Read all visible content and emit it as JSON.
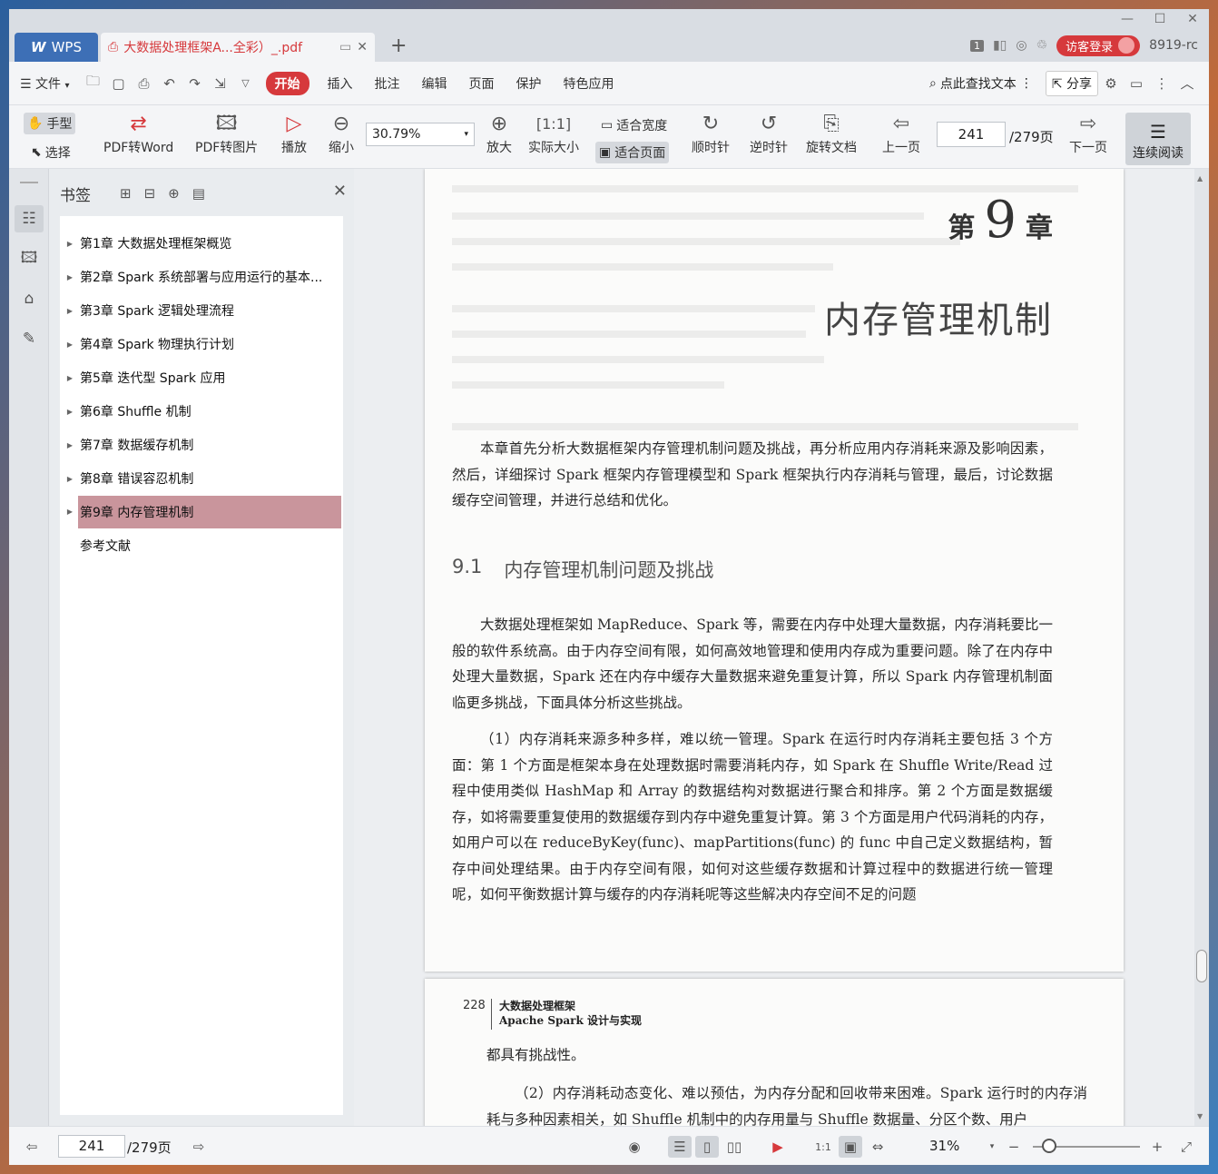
{
  "titlebar": {
    "app_label": "WPS",
    "doc_tab_title": "大数据处理框架A...全彩）_.pdf",
    "page_badge": "1",
    "login_label": "访客登录",
    "user_id": "8919-rc"
  },
  "menubar": {
    "file": "文件",
    "tabs": [
      "开始",
      "插入",
      "批注",
      "编辑",
      "页面",
      "保护",
      "特色应用"
    ],
    "search_label": "点此查找文本",
    "share": "分享"
  },
  "toolbar": {
    "hand": "手型",
    "select": "选择",
    "pdf2word": "PDF转Word",
    "pdf2img": "PDF转图片",
    "play": "播放",
    "zoom_out": "缩小",
    "zoom_value": "30.79%",
    "zoom_in": "放大",
    "actual_size": "实际大小",
    "fit_width": "适合宽度",
    "fit_page": "适合页面",
    "clockwise": "顺时针",
    "counterclockwise": "逆时针",
    "rotate_doc": "旋转文档",
    "prev_page": "上一页",
    "page_current": "241",
    "page_total": "/279页",
    "next_page": "下一页",
    "continuous": "连续阅读"
  },
  "bookmarks": {
    "title": "书签",
    "items": [
      "第1章 大数据处理框架概览",
      "第2章 Spark 系统部署与应用运行的基本...",
      "第3章 Spark 逻辑处理流程",
      "第4章 Spark 物理执行计划",
      "第5章 迭代型 Spark 应用",
      "第6章 Shuffle 机制",
      "第7章 数据缓存机制",
      "第8章 错误容忍机制",
      "第9章 内存管理机制",
      "参考文献"
    ]
  },
  "page1": {
    "chapter_prefix": "第",
    "chapter_number": "9",
    "chapter_suffix": "章",
    "chapter_title": "内存管理机制",
    "intro": "本章首先分析大数据框架内存管理机制问题及挑战，再分析应用内存消耗来源及影响因素，然后，详细探讨 Spark 框架内存管理模型和 Spark 框架执行内存消耗与管理，最后，讨论数据缓存空间管理，并进行总结和优化。",
    "section_number": "9.1",
    "section_title": "内存管理机制问题及挑战",
    "para1": "大数据处理框架如 MapReduce、Spark 等，需要在内存中处理大量数据，内存消耗要比一般的软件系统高。由于内存空间有限，如何高效地管理和使用内存成为重要问题。除了在内存中处理大量数据，Spark 还在内存中缓存大量数据来避免重复计算，所以 Spark 内存管理机制面临更多挑战，下面具体分析这些挑战。",
    "para2": "（1）内存消耗来源多种多样，难以统一管理。Spark 在运行时内存消耗主要包括 3 个方面：第 1 个方面是框架本身在处理数据时需要消耗内存，如 Spark 在 Shuffle Write/Read 过程中使用类似 HashMap 和 Array 的数据结构对数据进行聚合和排序。第 2 个方面是数据缓存，如将需要重复使用的数据缓存到内存中避免重复计算。第 3 个方面是用户代码消耗的内存，如用户可以在 reduceByKey(func)、mapPartitions(func) 的 func 中自己定义数据结构，暂存中间处理结果。由于内存空间有限，如何对这些缓存数据和计算过程中的数据进行统一管理呢，如何平衡数据计算与缓存的内存消耗呢等这些解决内存空间不足的问题"
  },
  "page2": {
    "page_number": "228",
    "book_title_line1": "大数据处理框架",
    "book_title_line2": "Apache Spark 设计与实现",
    "cont": "都具有挑战性。",
    "para3": "（2）内存消耗动态变化、难以预估，为内存分配和回收带来困难。Spark 运行时的内存消耗与多种因素相关，如 Shuffle 机制中的内存用量与 Shuffle 数据量、分区个数、用户"
  },
  "statusbar": {
    "page_current": "241",
    "page_total": "/279页",
    "zoom_percent": "31%"
  },
  "colors": {
    "accent": "#d6393c",
    "active_bookmark": "#c9959c",
    "wps_blue": "#3d6fb6"
  }
}
